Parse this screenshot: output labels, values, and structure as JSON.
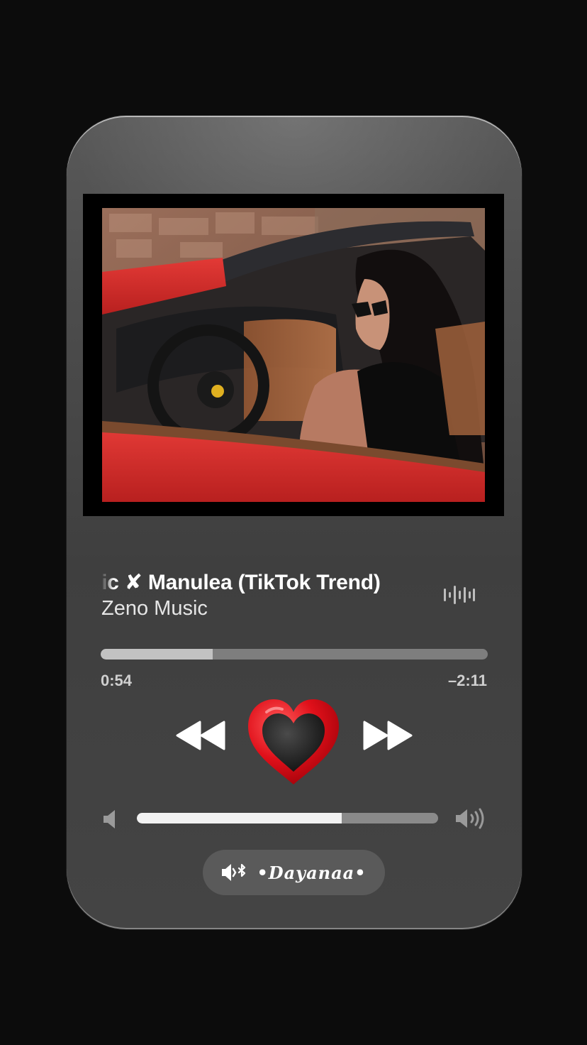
{
  "now_playing": {
    "title": "ic ✘ Manulea (TikTok Trend)",
    "artist": "Zeno Music",
    "artwork_icon": "album-artwork-woman-in-red-convertible",
    "waveform_icon": "waveform-icon"
  },
  "progress": {
    "elapsed": "0:54",
    "remaining": "–2:11",
    "fraction": 0.29
  },
  "controls": {
    "rewind_icon": "rewind-icon",
    "heart_icon": "heart-icon",
    "forward_icon": "fast-forward-icon"
  },
  "volume": {
    "low_icon": "speaker-low-icon",
    "high_icon": "speaker-high-icon",
    "level": 0.68
  },
  "device": {
    "icon": "speaker-bluetooth-icon",
    "name": "•Dayanaa•"
  },
  "colors": {
    "background": "#0c0c0c",
    "card": "#4a4a4a",
    "heart_red": "#e0101a",
    "heart_inner": "#1a1a1a",
    "car_red": "#d92a2a"
  }
}
